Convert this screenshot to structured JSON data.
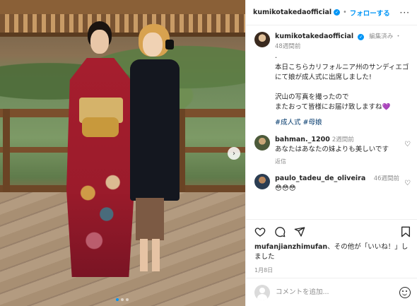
{
  "post": {
    "author": "kumikotakedaofficial",
    "follow_label": "フォローする",
    "separator": "•"
  },
  "caption": {
    "author": "kumikotakedaofficial",
    "edited_label": "編集済み",
    "dot": "・",
    "time": "48週間前",
    "lead": ".",
    "text": "本日こちらカリフォルニア州のサンディエゴにて娘が成人式に出席しました!\n\n沢山の写真を撮ったので\nまたおって皆様にお届け致しますね💜",
    "hashtags": "#成人式 #母娘"
  },
  "comments": [
    {
      "user": "bahman._1200",
      "time": "2週間前",
      "text": "あなたはあなたの妹よりも美しいです",
      "reply_label": "返信"
    },
    {
      "user": "paulo_tadeu_de_oliveira",
      "time": "46週間前",
      "text": "😳😳😳"
    }
  ],
  "likes": {
    "user": "mufanjianzhimufan",
    "text": "、その他が「いいね！」しました"
  },
  "date": "1月8日",
  "comment_input": {
    "placeholder": "コメントを追加..."
  },
  "icons": {
    "verified": "verified-badge-icon",
    "more": "more-options-icon",
    "like": "heart-icon",
    "comment": "comment-icon",
    "share": "share-icon",
    "save": "bookmark-icon",
    "emoji": "emoji-icon",
    "next": "chevron-right-icon"
  },
  "colors": {
    "accent": "#0095f6",
    "hashtag": "#00376b",
    "muted": "#8e8e8e"
  },
  "carousel": {
    "slide_count": 3,
    "active_index": 0
  }
}
